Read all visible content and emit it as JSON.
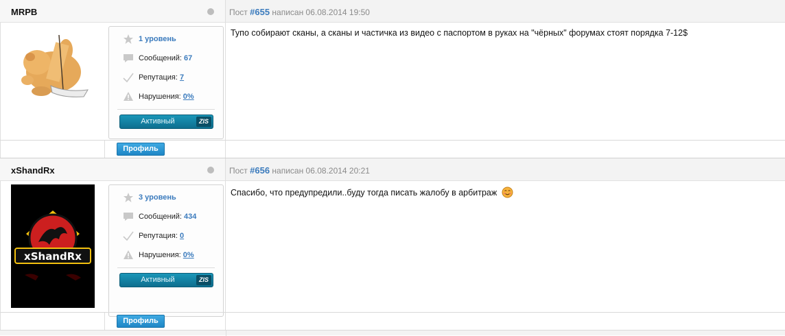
{
  "posts": [
    {
      "username": "MRPB",
      "post_label": "Пост",
      "post_number": "#655",
      "posted_text": "написан 06.08.2014 19:50",
      "message": "Тупо собирают сканы, а сканы и частичка из видео с паспортом в руках на \"чёрных\" форумах стоят порядка 7-12$",
      "level": "1 уровень",
      "messages_label": "Сообщений:",
      "messages_count": "67",
      "reputation_label": "Репутация:",
      "reputation_value": "7",
      "violations_label": "Нарушения:",
      "violations_value": "0%",
      "status_badge": "Активный",
      "badge_tag": "ZIS",
      "profile_button": "Профиль"
    },
    {
      "username": "xShandRx",
      "post_label": "Пост",
      "post_number": "#656",
      "posted_text": "написан 06.08.2014 20:21",
      "message": "Спасибо, что предупредили..буду тогда писать жалобу в арбитраж",
      "level": "3 уровень",
      "messages_label": "Сообщений:",
      "messages_count": "434",
      "reputation_label": "Репутация:",
      "reputation_value": "0",
      "violations_label": "Нарушения:",
      "violations_value": "0%",
      "status_badge": "Активный",
      "badge_tag": "ZIS",
      "profile_button": "Профиль",
      "avatar_text": "xShandRx"
    }
  ],
  "icons": {
    "level": "star-icon",
    "messages": "speech-bubble-icon",
    "reputation": "checkmark-icon",
    "violations": "warning-icon",
    "online": "status-dot-icon",
    "smiley": "smiley-icon"
  },
  "colors": {
    "accent": "#3b7bbd",
    "badge": "#137f9f",
    "button": "#2a95d4"
  }
}
